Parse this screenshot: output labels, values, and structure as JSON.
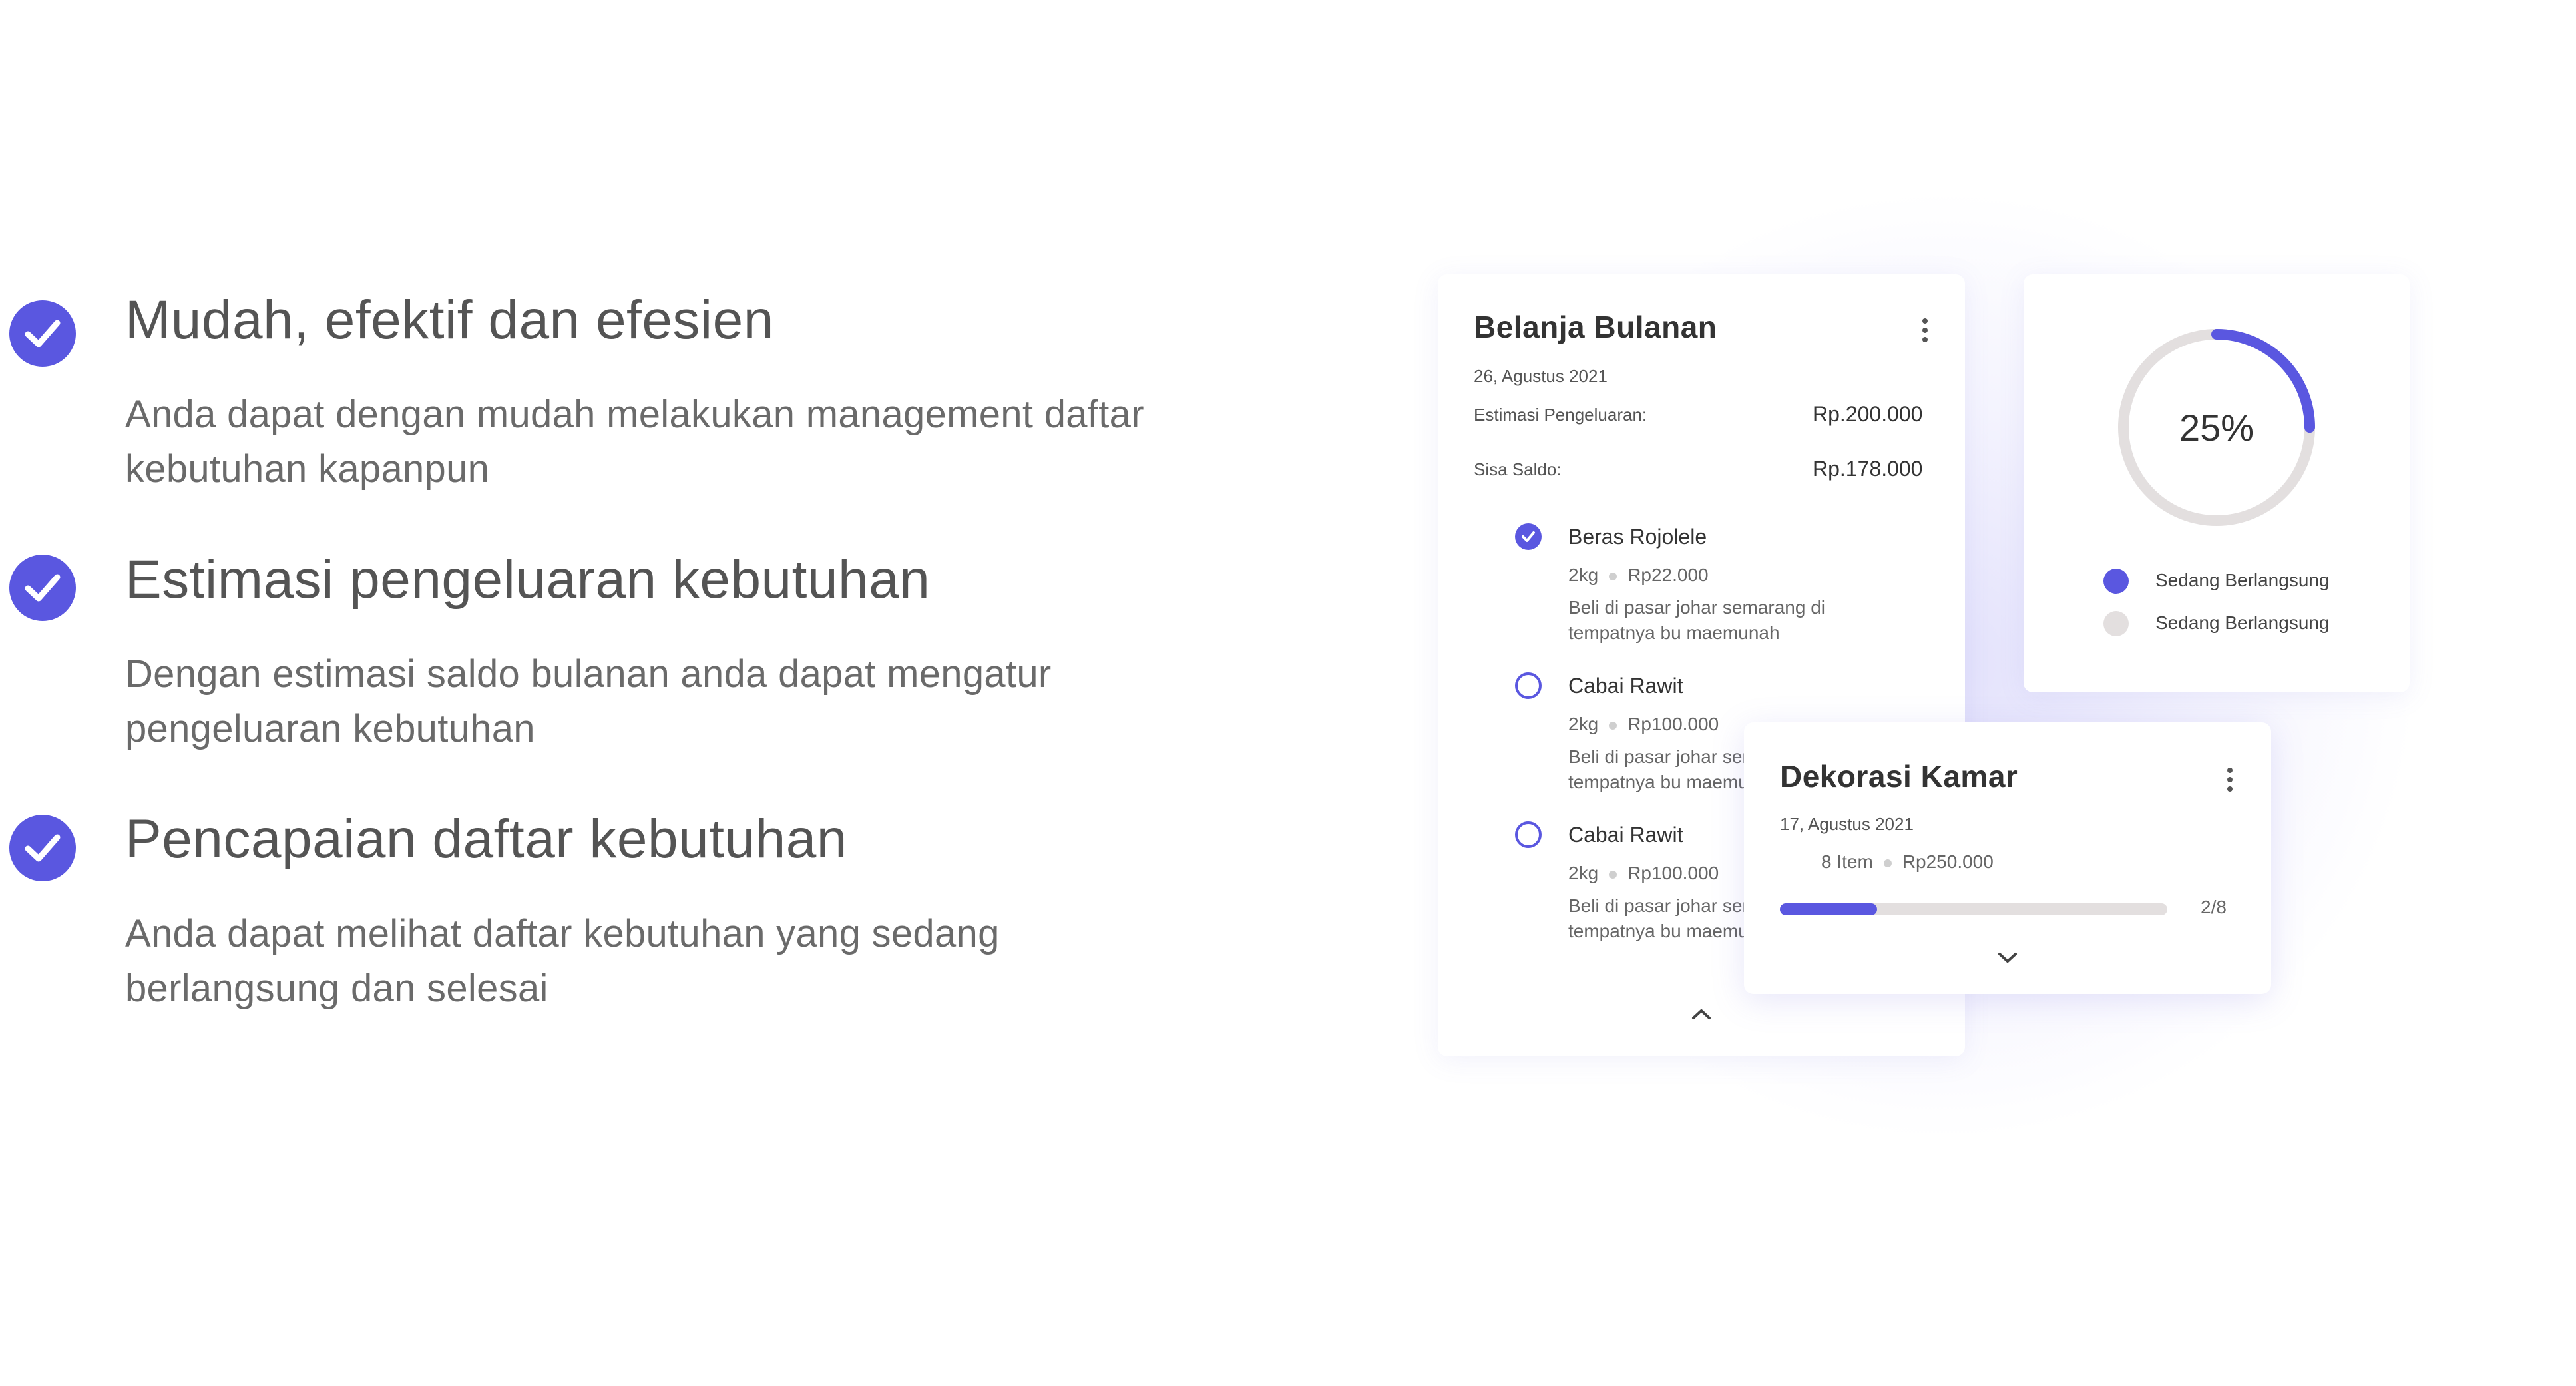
{
  "features": [
    {
      "title": "Mudah, efektif dan efesien",
      "desc": "Anda dapat dengan mudah melakukan management daftar kebutuhan kapanpun"
    },
    {
      "title": "Estimasi pengeluaran kebutuhan",
      "desc": "Dengan estimasi saldo bulanan anda dapat mengatur pengeluaran kebutuhan"
    },
    {
      "title": "Pencapaian daftar kebutuhan",
      "desc": "Anda dapat melihat daftar kebutuhan yang sedang berlangsung dan selesai"
    }
  ],
  "card_bulanan": {
    "title": "Belanja Bulanan",
    "date": "26, Agustus 2021",
    "estimate_label": "Estimasi Pengeluaran:",
    "estimate_value": "Rp.200.000",
    "balance_label": "Sisa Saldo:",
    "balance_value": "Rp.178.000",
    "items": [
      {
        "name": "Beras Rojolele",
        "qty": "2kg",
        "price": "Rp22.000",
        "note": "Beli di pasar johar semarang di tempatnya bu maemunah",
        "done": true
      },
      {
        "name": "Cabai Rawit",
        "qty": "2kg",
        "price": "Rp100.000",
        "note": "Beli di pasar johar semarang di tempatnya bu maemunah",
        "done": false
      },
      {
        "name": "Cabai Rawit",
        "qty": "2kg",
        "price": "Rp100.000",
        "note": "Beli di pasar johar semarang di tempatnya bu maemunah",
        "done": false
      }
    ]
  },
  "card_progress": {
    "percent_label": "25%",
    "percent": 25,
    "legend": [
      {
        "label": "Sedang Berlangsung",
        "color": "#5a57e0"
      },
      {
        "label": "Sedang Berlangsung",
        "color": "#e3dfdf"
      }
    ]
  },
  "card_dekorasi": {
    "title": "Dekorasi Kamar",
    "date": "17, Agustus 2021",
    "items_count": "8 Item",
    "amount": "Rp250.000",
    "progress_label": "2/8",
    "progress": 0.25
  },
  "colors": {
    "accent": "#5a57e0",
    "track": "#e3dfdf",
    "text_dark": "#333333"
  }
}
